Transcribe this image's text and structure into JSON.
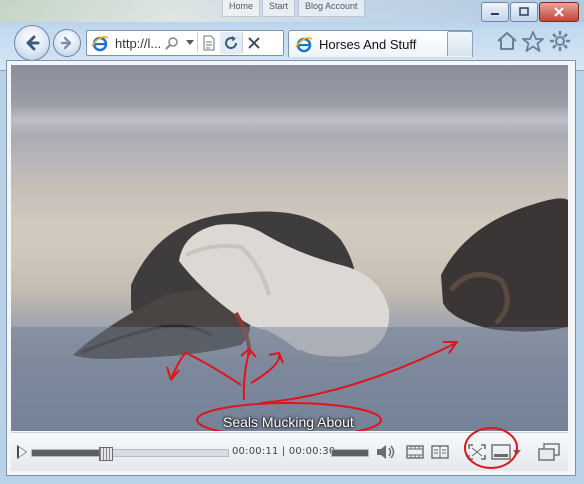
{
  "window": {
    "background_tabs": [
      "Home",
      "Start",
      "Blog Account"
    ],
    "minimize_label": "▭",
    "maximize_label": "▢",
    "close_label": "✕"
  },
  "browser": {
    "address_text": "http://l...",
    "tab_title": "Horses And Stuff",
    "icons": [
      "back-icon",
      "forward-icon",
      "ie-logo-icon",
      "search-icon",
      "dropdown-icon",
      "compat-view-icon",
      "refresh-icon",
      "stop-icon",
      "home-icon",
      "favorites-icon",
      "tools-gear-icon"
    ]
  },
  "video": {
    "caption": "Seals Mucking About"
  },
  "player": {
    "current_time": "00:00:11",
    "separator": "|",
    "total_time": "00:00:30",
    "progress": 0.37,
    "volume": 1.0,
    "icons": [
      "play-icon",
      "volume-icon",
      "chapters-icon",
      "playlist-icon",
      "fullscreen-icon",
      "captions-icon",
      "caption-menu-icon",
      "popout-icon"
    ]
  },
  "annotations": {
    "color": "#e0141a",
    "circled": [
      "caption",
      "captions-button"
    ]
  }
}
